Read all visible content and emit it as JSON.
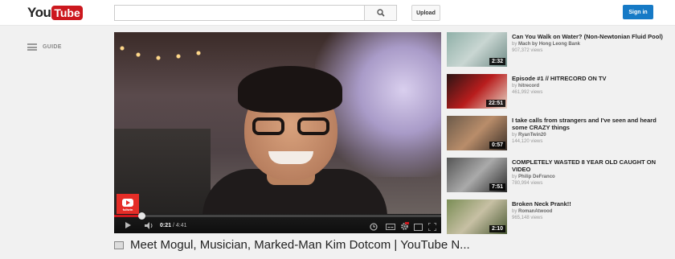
{
  "header": {
    "logo_you": "You",
    "logo_tube": "Tube",
    "search_value": "",
    "upload_label": "Upload",
    "signin_label": "Sign in"
  },
  "guide": {
    "label": "GUIDE"
  },
  "player": {
    "time_current": "0:21",
    "time_sep": " / ",
    "time_total": "4:41",
    "progress_fraction": 0.084,
    "badge_label": "fullwin"
  },
  "video": {
    "title": "Meet Mogul, Musician, Marked-Man Kim Dotcom | YouTube N..."
  },
  "related": [
    {
      "title": "Can You Walk on Water? (Non-Newtonian Fluid Pool)",
      "by": "by",
      "channel": "Mach by Hong Leong Bank",
      "views": "907,372 views",
      "duration": "2:32",
      "colors": [
        "#8fb0a8",
        "#c9d6d2",
        "#6f8b86"
      ]
    },
    {
      "title": "Episode #1 // HITRECORD ON TV",
      "by": "by",
      "channel": "hitrecord",
      "views": "461,992 views",
      "duration": "22:51",
      "colors": [
        "#2a1414",
        "#b81d1d",
        "#e6d7c8"
      ]
    },
    {
      "title": "I take calls from strangers and I've seen and heard some CRAZY things",
      "by": "by",
      "channel": "RyanTwin20",
      "views": "144,120 views",
      "duration": "0:57",
      "colors": [
        "#6b5a4a",
        "#b98d6a",
        "#3a2f28"
      ]
    },
    {
      "title": "COMPLETELY WASTED 8 YEAR OLD CAUGHT ON VIDEO",
      "by": "by",
      "channel": "Philip DeFranco",
      "views": "780,994 views",
      "duration": "7:51",
      "colors": [
        "#555555",
        "#aaaaaa",
        "#2a2a2a"
      ]
    },
    {
      "title": "Broken Neck Prank!!",
      "by": "by",
      "channel": "RomanAtwood",
      "views": "965,148 views",
      "duration": "2:10",
      "colors": [
        "#7a8d55",
        "#c7c0a4",
        "#4a5a34"
      ]
    }
  ],
  "colors": {
    "brand_red": "#cc181e",
    "signin_blue": "#167ac6"
  }
}
